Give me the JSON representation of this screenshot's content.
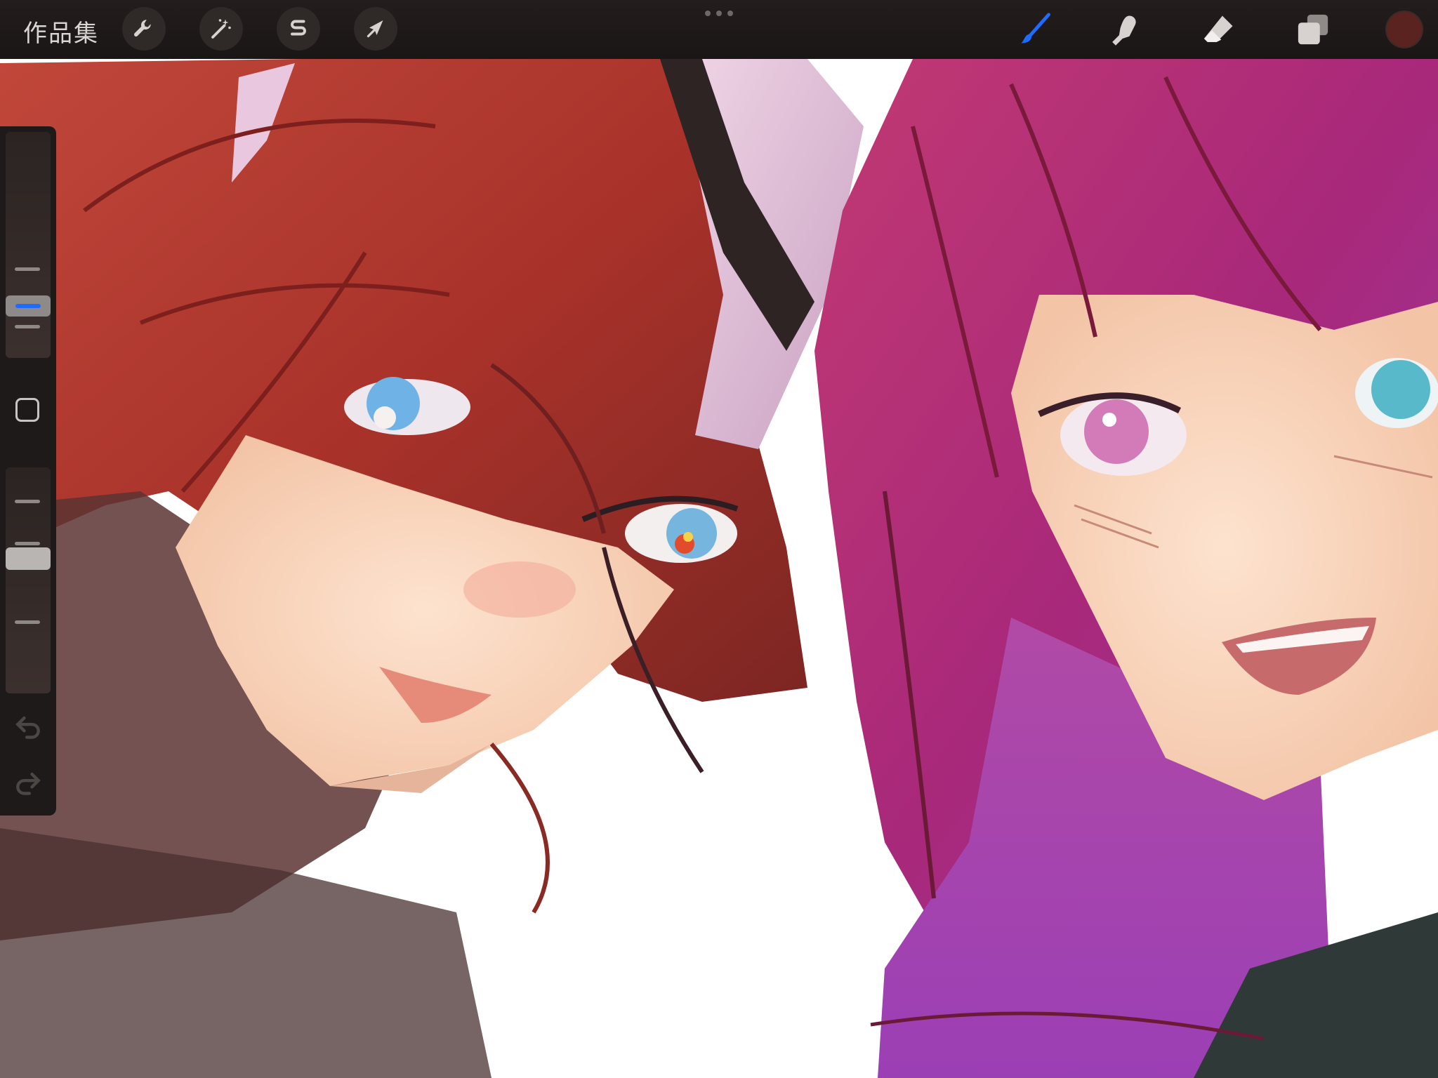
{
  "app": {
    "gallery_label": "作品集"
  },
  "toolbar": {
    "actions_icon": "wrench-icon",
    "adjustments_icon": "magic-wand-icon",
    "selection_icon": "selection-s-icon",
    "transform_icon": "arrow-cursor-icon",
    "more_icon": "ellipsis-icon",
    "brush_icon": "brush-icon",
    "smudge_icon": "smudge-finger-icon",
    "eraser_icon": "eraser-icon",
    "layers_icon": "layers-icon",
    "current_color": "#5a231f",
    "active_tool_color": "#1e6cff"
  },
  "sidebar": {
    "brush_size_level": 0.42,
    "opacity_level": 0.45,
    "modify_icon": "square-icon",
    "undo_icon": "undo-icon",
    "redo_icon": "redo-icon"
  }
}
